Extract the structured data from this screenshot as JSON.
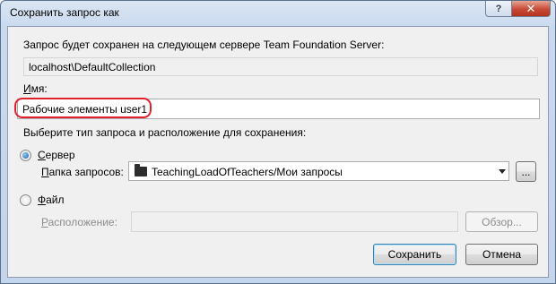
{
  "window": {
    "title": "Сохранить запрос как",
    "help_label": "?",
    "close_label": "✕"
  },
  "server": {
    "label": "Запрос будет сохранен на следующем сервере Team Foundation Server:",
    "value": "localhost\\DefaultCollection"
  },
  "name": {
    "label": "Имя:",
    "value": "Рабочие элементы user1"
  },
  "choose_label": "Выберите тип запроса и расположение для сохранения:",
  "server_option": {
    "label": "Сервер",
    "selected": true
  },
  "query_folder": {
    "label": "Папка запросов:",
    "value": "TeachingLoadOfTeachers/Мои запросы",
    "icon": "folder-icon",
    "browse_label": "..."
  },
  "file_option": {
    "label": "Файл",
    "selected": false
  },
  "location": {
    "label": "Расположение:",
    "value": "",
    "browse_label": "Обзор..."
  },
  "buttons": {
    "save": "Сохранить",
    "cancel": "Отмена"
  },
  "colors": {
    "highlight": "#e0202a",
    "close_button": "#c74a36",
    "radio_dot": "#1d5fa8"
  }
}
